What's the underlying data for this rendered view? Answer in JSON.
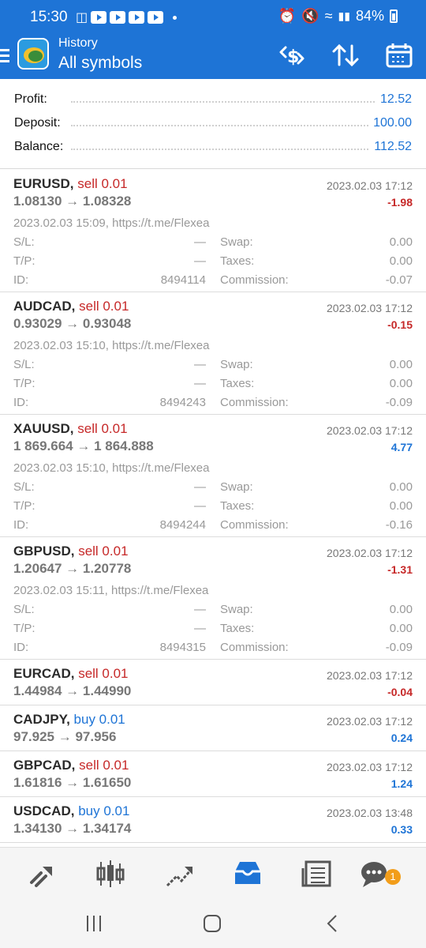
{
  "status_bar": {
    "time": "15:30",
    "battery": "84%"
  },
  "app_bar": {
    "subtitle": "History",
    "title": "All symbols"
  },
  "summary": [
    {
      "label": "Profit:",
      "value": "12.52"
    },
    {
      "label": "Deposit:",
      "value": "100.00"
    },
    {
      "label": "Balance:",
      "value": "112.52"
    }
  ],
  "detail_labels": {
    "sl": "S/L:",
    "tp": "T/P:",
    "id": "ID:",
    "swap": "Swap:",
    "taxes": "Taxes:",
    "commission": "Commission:"
  },
  "trades": [
    {
      "symbol": "EURUSD,",
      "side": "sell 0.01",
      "prices": "1.08130 → 1.08328",
      "time": "2023.02.03 17:12",
      "profit": "-1.98",
      "comment": "2023.02.03 15:09, https://t.me/Flexea",
      "sl": "—",
      "tp": "—",
      "id": "8494114",
      "swap": "0.00",
      "taxes": "0.00",
      "commission": "-0.07"
    },
    {
      "symbol": "AUDCAD,",
      "side": "sell 0.01",
      "prices": "0.93029 → 0.93048",
      "time": "2023.02.03 17:12",
      "profit": "-0.15",
      "comment": "2023.02.03 15:10, https://t.me/Flexea",
      "sl": "—",
      "tp": "—",
      "id": "8494243",
      "swap": "0.00",
      "taxes": "0.00",
      "commission": "-0.09"
    },
    {
      "symbol": "XAUUSD,",
      "side": "sell 0.01",
      "prices": "1 869.664 → 1 864.888",
      "time": "2023.02.03 17:12",
      "profit": "4.77",
      "comment": "2023.02.03 15:10, https://t.me/Flexea",
      "sl": "—",
      "tp": "—",
      "id": "8494244",
      "swap": "0.00",
      "taxes": "0.00",
      "commission": "-0.16"
    },
    {
      "symbol": "GBPUSD,",
      "side": "sell 0.01",
      "prices": "1.20647 → 1.20778",
      "time": "2023.02.03 17:12",
      "profit": "-1.31",
      "comment": "2023.02.03 15:11, https://t.me/Flexea",
      "sl": "—",
      "tp": "—",
      "id": "8494315",
      "swap": "0.00",
      "taxes": "0.00",
      "commission": "-0.09"
    },
    {
      "symbol": "EURCAD,",
      "side": "sell 0.01",
      "prices": "1.44984 → 1.44990",
      "time": "2023.02.03 17:12",
      "profit": "-0.04"
    },
    {
      "symbol": "CADJPY,",
      "side": "buy 0.01",
      "prices": "97.925 → 97.956",
      "time": "2023.02.03 17:12",
      "profit": "0.24"
    },
    {
      "symbol": "GBPCAD,",
      "side": "sell 0.01",
      "prices": "1.61816 → 1.61650",
      "time": "2023.02.03 17:12",
      "profit": "1.24"
    },
    {
      "symbol": "USDCAD,",
      "side": "buy 0.01",
      "prices": "1.34130 → 1.34174",
      "time": "2023.02.03 13:48",
      "profit": "0.33"
    }
  ],
  "bottom_nav": {
    "chat_badge": "1"
  },
  "colors": {
    "accent": "#1e74d6",
    "loss": "#c62828",
    "badge": "#f29d1a"
  }
}
